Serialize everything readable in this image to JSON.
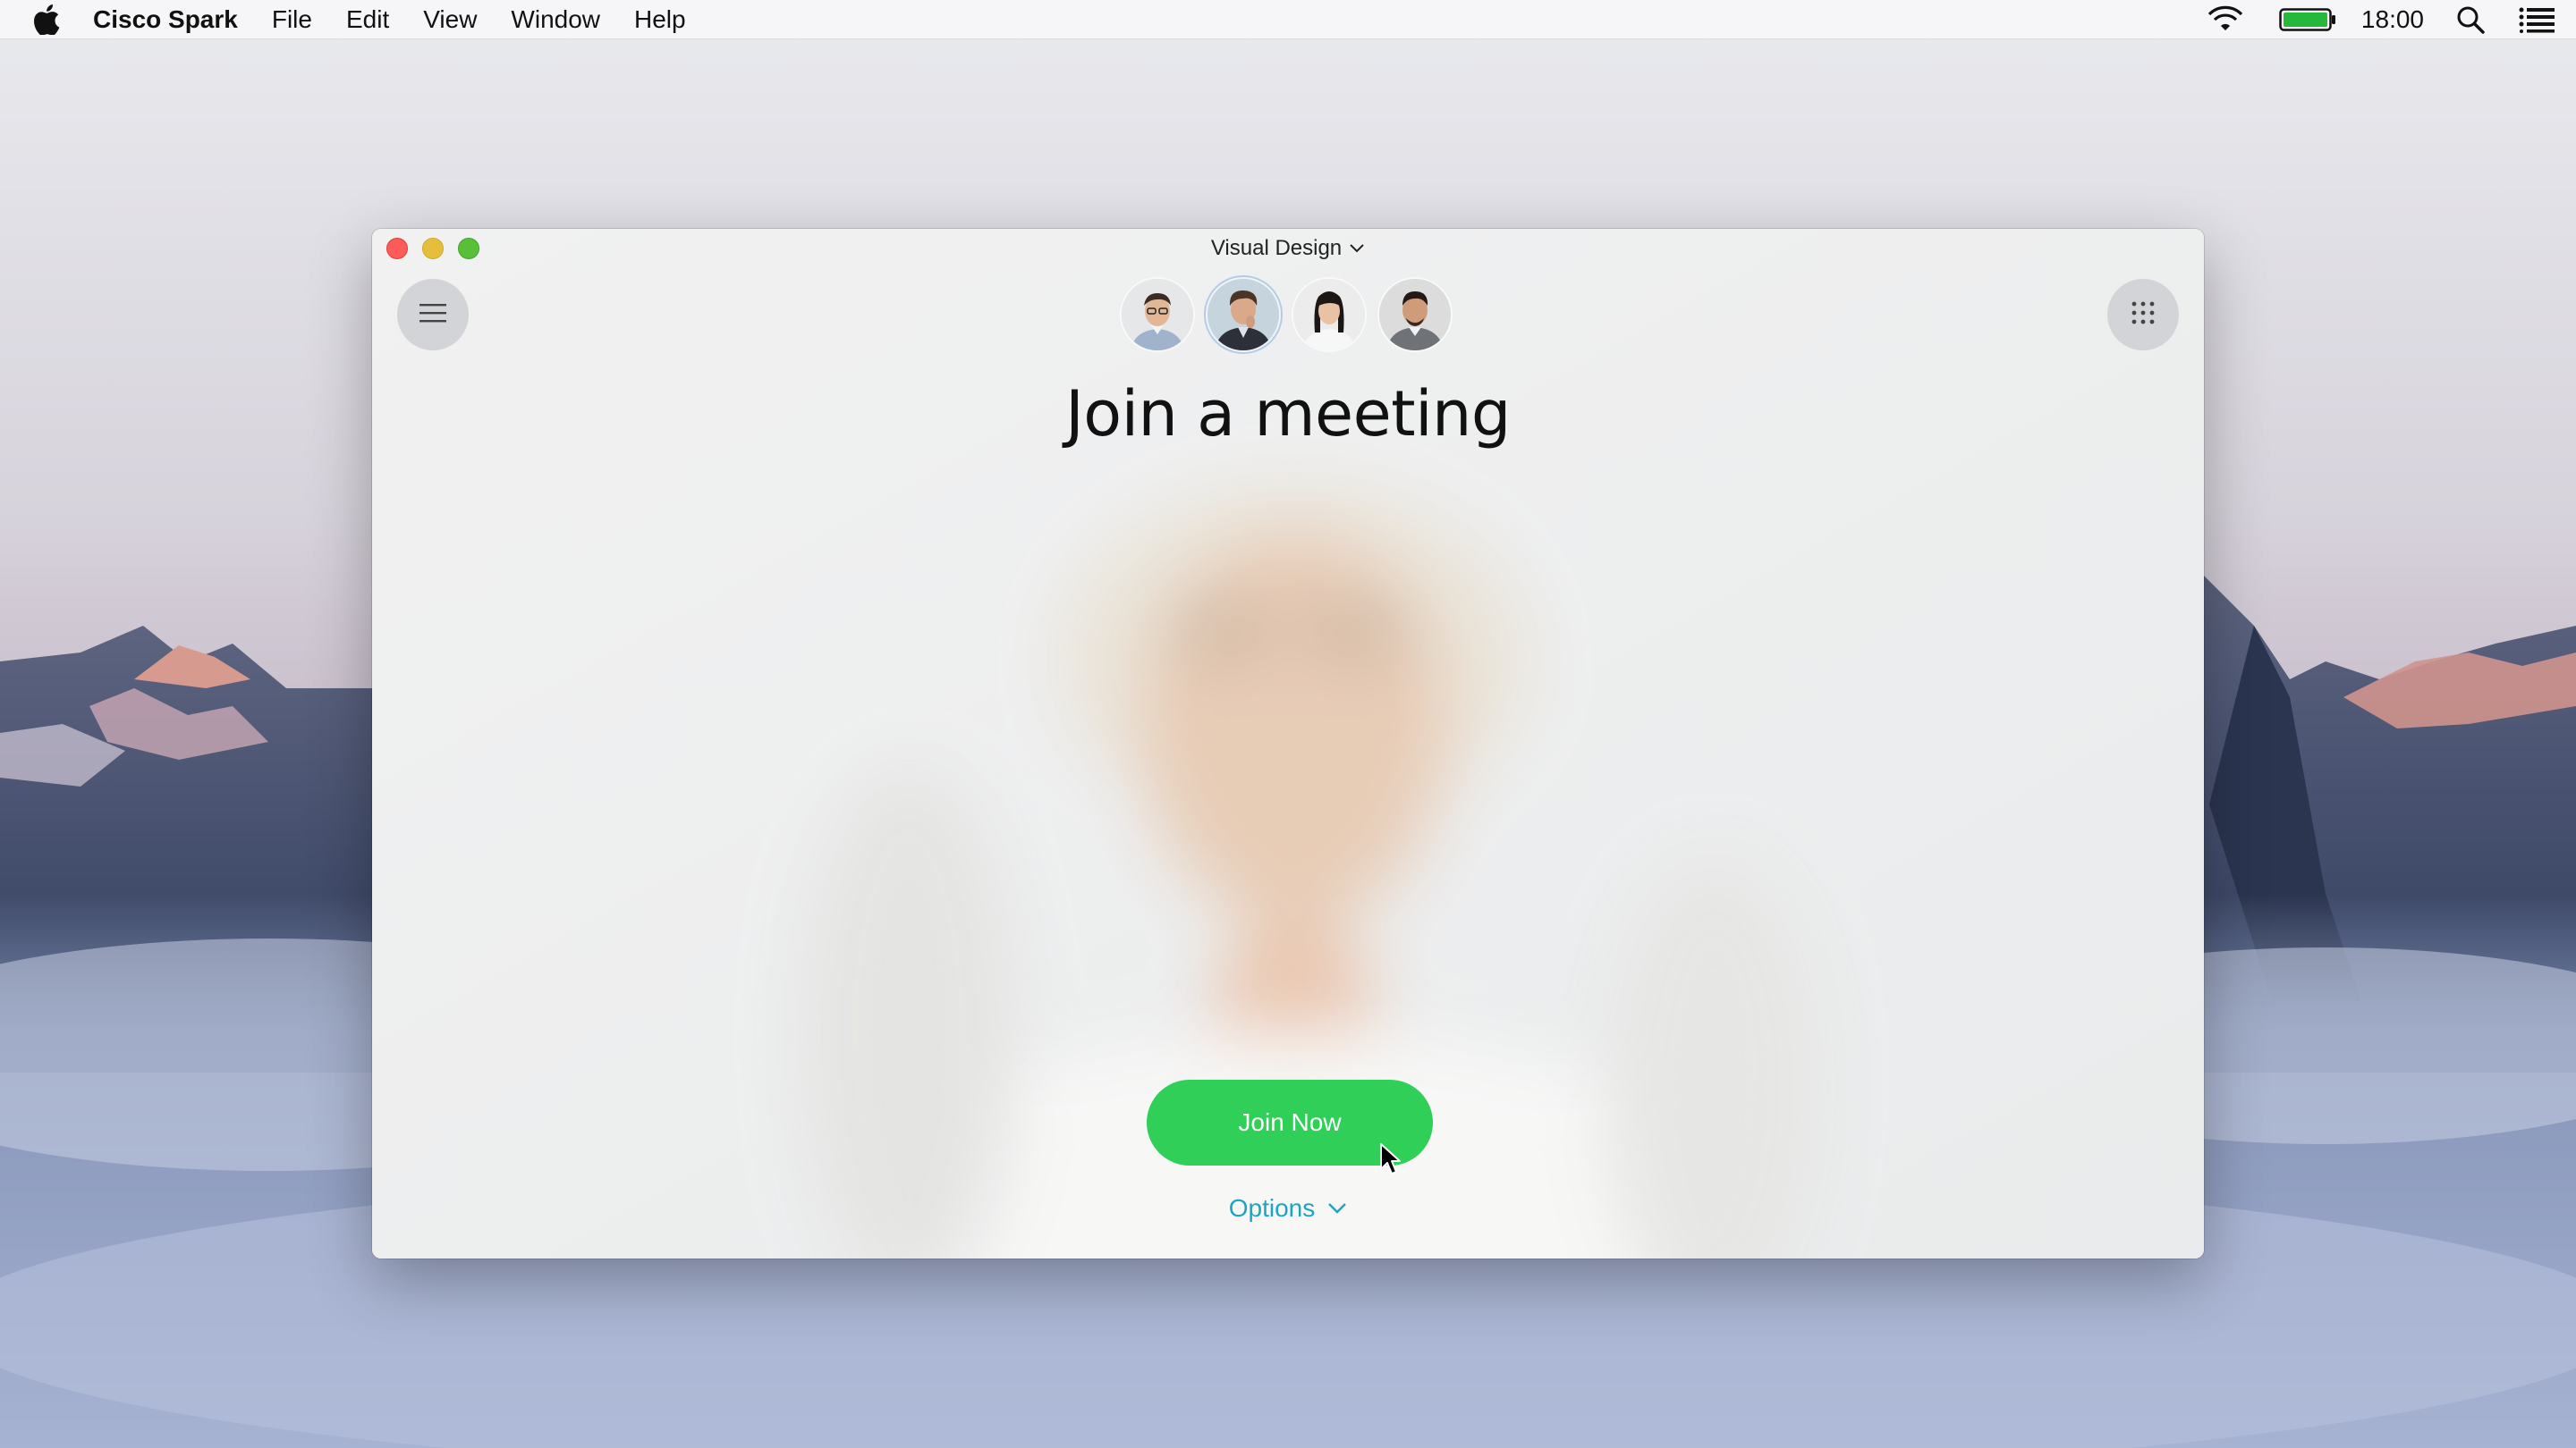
{
  "menubar": {
    "app_name": "Cisco Spark",
    "menus": [
      "File",
      "Edit",
      "View",
      "Window",
      "Help"
    ],
    "clock": "18:00",
    "icons": [
      "apple-icon",
      "wifi-icon",
      "battery-icon",
      "spotlight-icon",
      "notification-list-icon"
    ]
  },
  "window": {
    "space_title": "Visual Design",
    "headline": "Join a meeting",
    "join_button_label": "Join Now",
    "options_label": "Options",
    "participants": [
      {
        "avatar": "participant-1",
        "active": false
      },
      {
        "avatar": "participant-2",
        "active": true
      },
      {
        "avatar": "participant-3",
        "active": false
      },
      {
        "avatar": "participant-4",
        "active": false
      }
    ]
  },
  "colors": {
    "join_button": "#2fcf58",
    "options_link": "#1fa3c2",
    "close": "#fc5b57",
    "minimize": "#e5bf3c",
    "zoom": "#57c038",
    "battery_fill": "#25b83a"
  }
}
